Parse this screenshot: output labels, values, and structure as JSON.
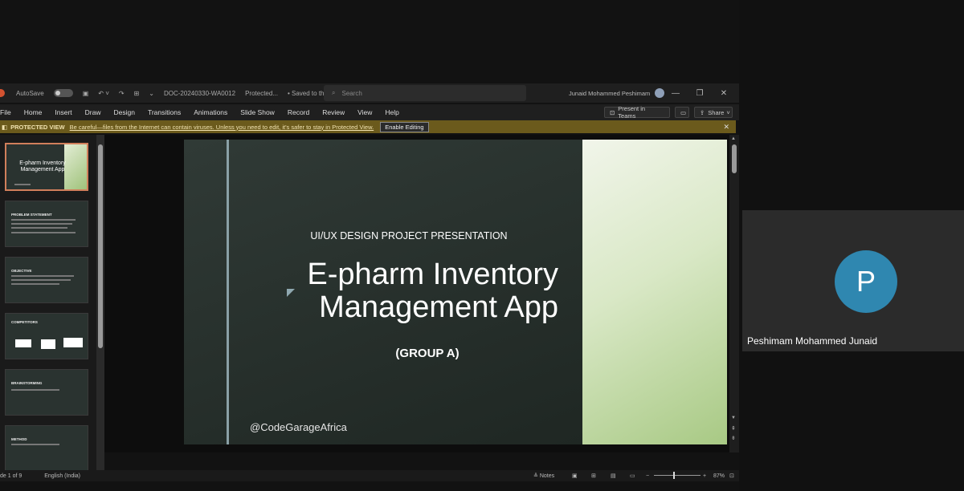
{
  "window": {
    "autosave_label": "AutoSave",
    "doc_name": "DOC-20240330-WA0012",
    "protected": "Protected...",
    "saved": "• Saved to this PC",
    "search_placeholder": "Search",
    "user_name": "Junaid Mohammed Peshimam"
  },
  "ribbon": {
    "tabs": [
      "File",
      "Home",
      "Insert",
      "Draw",
      "Design",
      "Transitions",
      "Animations",
      "Slide Show",
      "Record",
      "Review",
      "View",
      "Help"
    ],
    "present_in_teams": "Present in Teams",
    "share": "Share"
  },
  "protected_bar": {
    "title": "PROTECTED VIEW",
    "message": "Be careful—files from the Internet can contain viruses. Unless you need to edit, it's safer to stay in Protected View.",
    "button": "Enable Editing"
  },
  "thumbnails": [
    {
      "title": "E-pharm Inventory Management App"
    },
    {
      "title": "PROBLEM STATEMENT"
    },
    {
      "title": "OBJECTIVE"
    },
    {
      "title": "COMPETITORS"
    },
    {
      "title": "BRAINSTORMING"
    },
    {
      "title": "METHOD"
    }
  ],
  "slide": {
    "subtitle": "UI/UX DESIGN PROJECT PRESENTATION",
    "title_line1": "E-pharm Inventory",
    "title_line2": "Management App",
    "group": "(GROUP A)",
    "handle": "@CodeGarageAfrica"
  },
  "status": {
    "slide_of": "de 1 of 9",
    "language": "English (India)",
    "notes": "Notes",
    "zoom": "87%"
  },
  "participant": {
    "initial": "P",
    "name": "Peshimam Mohammed Junaid",
    "avatar_color": "#2f87b0"
  }
}
